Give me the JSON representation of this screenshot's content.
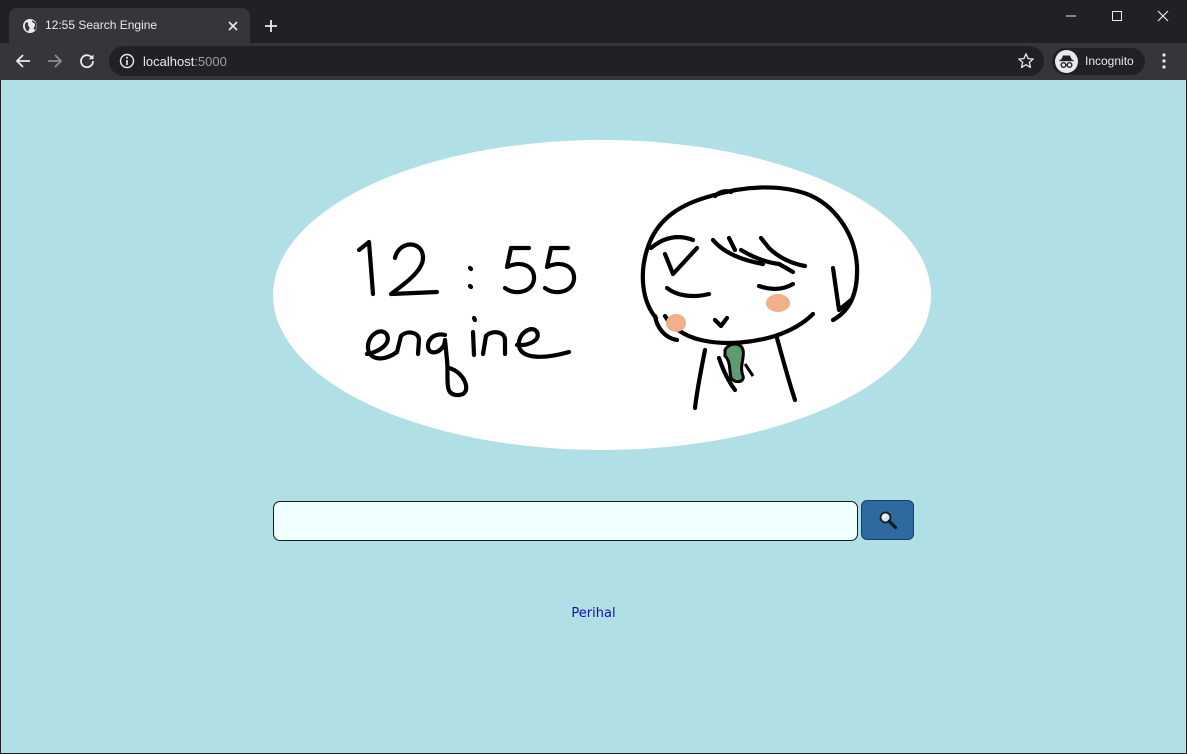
{
  "browser": {
    "tab_title": "12:55 Search Engine",
    "url_host": "localhost",
    "url_port": ":5000",
    "profile_label": "Incognito",
    "icons": [
      "globe-icon",
      "close-icon",
      "plus-icon",
      "minimize-icon",
      "maximize-icon",
      "close-icon",
      "back-icon",
      "forward-icon",
      "reload-icon",
      "info-icon",
      "star-icon",
      "incognito-icon",
      "more-vert-icon"
    ]
  },
  "page": {
    "logo": {
      "line1": "12 : 55",
      "line2": "engine"
    },
    "search": {
      "value": "",
      "button_icon": "magnifier-icon"
    },
    "about_link": "Perihal",
    "colors": {
      "background": "#b0dfe5",
      "search_input_bg": "#f0ffff",
      "search_button_bg": "#2e6a9e",
      "link": "#1a0dab",
      "blush": "#f0b08a",
      "bowtie": "#5e9a72"
    }
  }
}
